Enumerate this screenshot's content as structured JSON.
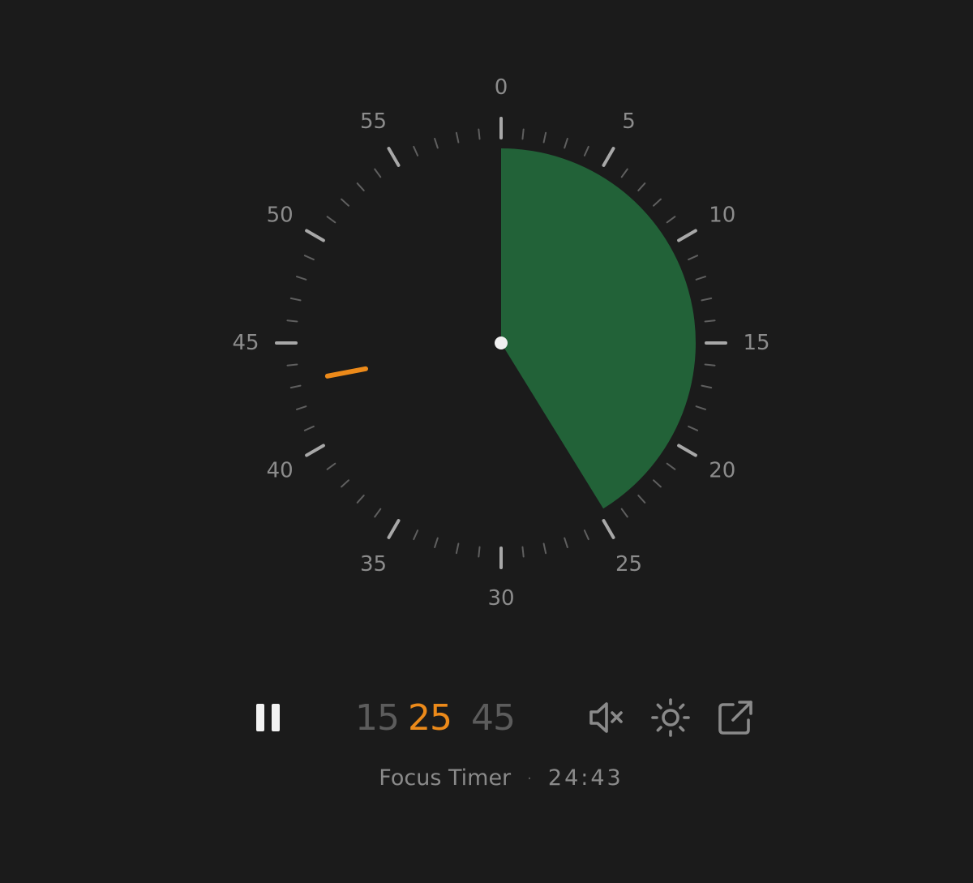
{
  "dial": {
    "minute_labels": [
      "0",
      "5",
      "10",
      "15",
      "20",
      "25",
      "30",
      "35",
      "40",
      "45",
      "50",
      "55"
    ],
    "remaining_minutes": 24.72,
    "hand_minute": 43.2,
    "colors": {
      "remaining_fill": "#226238",
      "hand": "#ec8a1a",
      "major_tick": "#a8a8a8",
      "minor_tick": "#5f5f5f",
      "center_dot": "#f0f0f0",
      "labels": "#8c8c8c"
    }
  },
  "controls": {
    "pause_icon": "pause-icon",
    "presets": [
      {
        "label": "15",
        "active": false
      },
      {
        "label": "25",
        "active": true
      },
      {
        "label": "45",
        "active": false
      }
    ],
    "mute_icon": "volume-muted-icon",
    "theme_icon": "sun-icon",
    "popout_icon": "external-link-icon"
  },
  "status": {
    "title": "Focus Timer",
    "separator": "·",
    "remaining_time": "24:43"
  },
  "colors": {
    "background": "#1b1b1b",
    "accent": "#ec8a1a",
    "icon": "#8a8a8a",
    "inactive_preset": "#5c5c5c"
  }
}
